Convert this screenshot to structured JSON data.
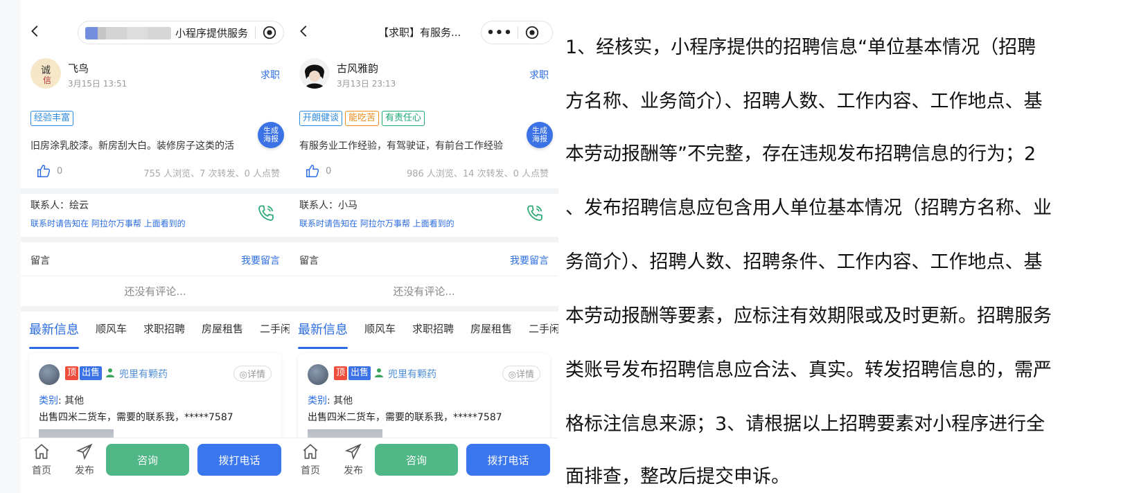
{
  "left_phone": {
    "nav_title": "小程序提供服务",
    "user": {
      "name": "飞鸟",
      "time": "3月15日 13:51",
      "category": "求职"
    },
    "tags": [
      {
        "text": "经验丰富",
        "color": "#2b8ae0"
      }
    ],
    "poster_label": "生成海报",
    "description": "旧房涂乳胶漆。新房刮大白。装修房子这类的活",
    "likes": "0",
    "stats": "755 人浏览、7 次转发、0 人点赞",
    "contact": {
      "name": "联系人：绘云",
      "note": "联系时请告知在 阿拉尔万事帮 上面看到的"
    },
    "comments": {
      "label": "留言",
      "action": "我要留言",
      "empty": "还没有评论..."
    },
    "tabs": [
      "最新信息",
      "顺风车",
      "求职招聘",
      "房屋租售",
      "二手闲"
    ],
    "card": {
      "badge_top": "顶",
      "badge_sell": "出售",
      "user": "兜里有颗药",
      "detail": "详情",
      "category_key": "类别",
      "category_val": ": 其他",
      "text": "出售四米二货车，需要的联系我，*****7587"
    },
    "bottom": {
      "home": "首页",
      "publish": "发布",
      "consult": "咨询",
      "call": "拨打电话"
    }
  },
  "right_phone": {
    "nav_title": "【求职】有服务...",
    "user": {
      "name": "古风雅韵",
      "time": "3月13日 23:13",
      "category": "求职"
    },
    "tags": [
      {
        "text": "开朗健谈",
        "color": "#2b8ae0"
      },
      {
        "text": "能吃苦",
        "color": "#f08c1a"
      },
      {
        "text": "有责任心",
        "color": "#1aa873"
      }
    ],
    "poster_label": "生成海报",
    "description": "有服务业工作经验，有驾驶证，有前台工作经验",
    "likes": "0",
    "stats": "986 人浏览、14 次转发、0 人点赞",
    "contact": {
      "name": "联系人：小马",
      "note": "联系时请告知在 阿拉尔万事帮 上面看到的"
    },
    "comments": {
      "label": "留言",
      "action": "我要留言",
      "empty": "还没有评论..."
    },
    "tabs": [
      "最新信息",
      "顺风车",
      "求职招聘",
      "房屋租售",
      "二手闲"
    ],
    "card": {
      "badge_top": "顶",
      "badge_sell": "出售",
      "user": "兜里有颗药",
      "detail": "详情",
      "category_key": "类别",
      "category_val": ": 其他",
      "text": "出售四米二货车，需要的联系我，*****7587"
    },
    "bottom": {
      "home": "首页",
      "publish": "发布",
      "consult": "咨询",
      "call": "拨打电话"
    }
  },
  "notice_lines": [
    "1、经核实，小程序提供的招聘信息“单位基本情况（招聘",
    "方名称、业务简介）、招聘人数、工作内容、工作地点、基",
    "本劳动报酬等”不完整，存在违规发布招聘信息的行为；2",
    "、发布招聘信息应包含用人单位基本情况（招聘方名称、业",
    "务简介）、招聘人数、招聘条件、工作内容、工作地点、基",
    "本劳动报酬等要素，应标注有效期限或及时更新。招聘服务",
    "类账号发布招聘信息应合法、真实。转发招聘信息的，需严",
    "格标注信息来源；3、请根据以上招聘要素对小程序进行全",
    "面排查，整改后提交申诉。"
  ]
}
